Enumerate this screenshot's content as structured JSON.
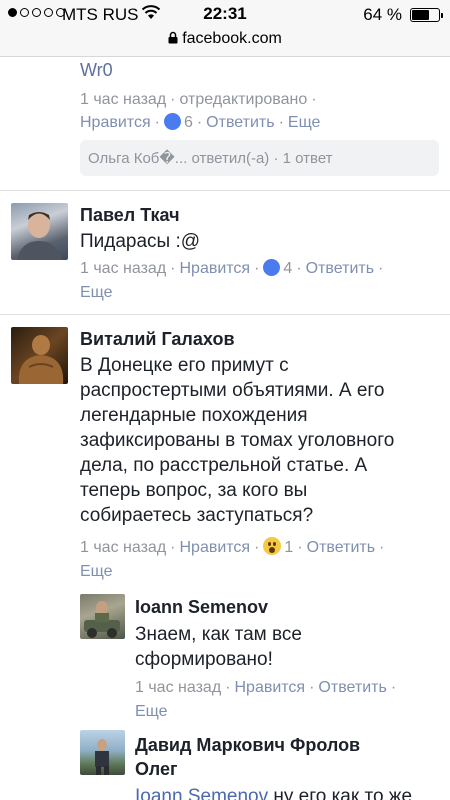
{
  "status_bar": {
    "carrier": "MTS RUS",
    "time": "22:31",
    "battery_percent": "64 %",
    "battery_level": 0.64
  },
  "browser": {
    "url": "facebook.com"
  },
  "comment_top": {
    "author_fragment": "Wr0",
    "time": "1 час назад",
    "edited": "отредактировано",
    "like": "Нравится",
    "like_count": "6",
    "reply": "Ответить",
    "more": "Еще",
    "replies_summary": "Ольга Коб�... ответил(-а) · 1 ответ"
  },
  "comment_pavel": {
    "author": "Павел Ткач",
    "text": "Пидарасы :@",
    "time": "1 час назад",
    "like": "Нравится",
    "like_count": "4",
    "reply": "Ответить",
    "more": "Еще"
  },
  "comment_vitaliy": {
    "author": "Виталий Галахов",
    "text_lines": [
      "В Донецке его примут с",
      "распростертыми объятиями. А его",
      "легендарные похождения",
      "зафиксированы в томах уголовного",
      "дела, по расстрельной статье. А",
      "теперь вопрос, за кого вы",
      "собираетесь заступаться?"
    ],
    "time": "1 час назад",
    "like": "Нравится",
    "reaction_count": "1",
    "reply": "Ответить",
    "more": "Еще"
  },
  "reply_ioann": {
    "author": "Ioann Semenov",
    "text_lines": [
      "Знаем, как там все",
      "сформировано!"
    ],
    "time": "1 час назад",
    "like": "Нравится",
    "reply": "Ответить",
    "more": "Еще"
  },
  "reply_david": {
    "author_line1": "Давид Маркович Фролов",
    "author_line2": "Олег",
    "mention": "Ioann Semenov",
    "text_start": " ну его как то же"
  }
}
